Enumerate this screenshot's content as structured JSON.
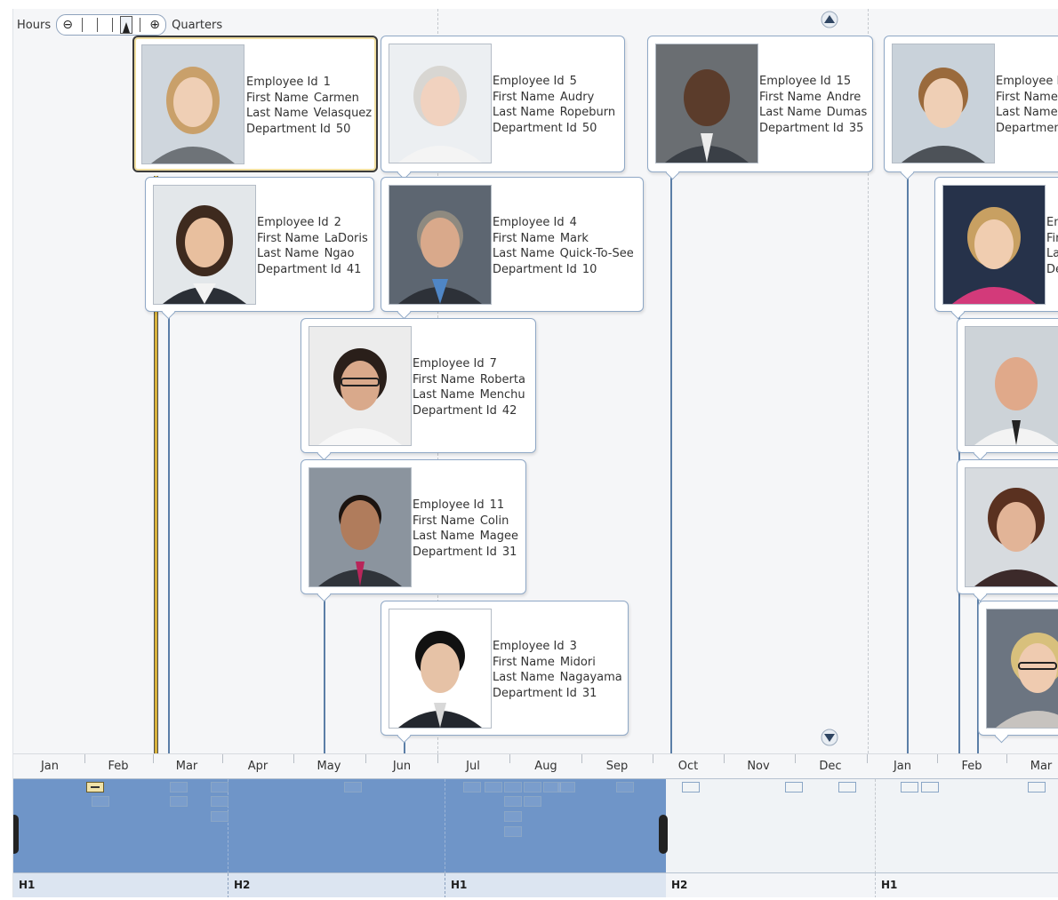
{
  "zoom": {
    "left_label": "Hours",
    "right_label": "Quarters",
    "zoom_out_glyph": "⊖",
    "zoom_in_glyph": "⊕",
    "level_fraction": 0.62
  },
  "field_labels": {
    "employee_id": "Employee Id",
    "first_name": "First Name",
    "last_name": "Last Name",
    "department_id": "Department Id"
  },
  "employees": [
    {
      "employee_id": "1",
      "first_name": "Carmen",
      "last_name": "Velasquez",
      "department_id": "50",
      "selected": true
    },
    {
      "employee_id": "5",
      "first_name": "Audry",
      "last_name": "Ropeburn",
      "department_id": "50"
    },
    {
      "employee_id": "15",
      "first_name": "Andre",
      "last_name": "Dumas",
      "department_id": "35"
    },
    {
      "employee_id": "I",
      "first_name": "",
      "last_name": "",
      "department_id": ""
    },
    {
      "employee_id": "2",
      "first_name": "LaDoris",
      "last_name": "Ngao",
      "department_id": "41"
    },
    {
      "employee_id": "4",
      "first_name": "Mark",
      "last_name": "Quick-To-See",
      "department_id": "10"
    },
    {
      "employee_id": "7",
      "first_name": "Roberta",
      "last_name": "Menchu",
      "department_id": "42"
    },
    {
      "employee_id": "11",
      "first_name": "Colin",
      "last_name": "Magee",
      "department_id": "31"
    },
    {
      "employee_id": "3",
      "first_name": "Midori",
      "last_name": "Nagayama",
      "department_id": "31"
    }
  ],
  "partial_labels": {
    "emp_i_label": "Employee I",
    "first_name": "First Name",
    "last_name": "Last Name",
    "department": "Departmen",
    "cut1": "En",
    "cut2": "Fir",
    "cut3": "La",
    "cut4": "De"
  },
  "months": [
    "Jan",
    "Feb",
    "Mar",
    "Apr",
    "May",
    "Jun",
    "Jul",
    "Aug",
    "Sep",
    "Oct",
    "Nov",
    "Dec",
    "Jan",
    "Feb",
    "Mar"
  ],
  "halves": [
    "H1",
    "H2",
    "H1",
    "H2",
    "H1"
  ],
  "colors": {
    "accent": "#6f95c8",
    "stem": "#5b7ea7",
    "selected": "#d8b23c"
  },
  "icons": {
    "scroll_up": "triangle-up-icon",
    "scroll_down": "triangle-down-icon",
    "zoom_in": "zoom-in-icon",
    "zoom_out": "zoom-out-icon"
  }
}
